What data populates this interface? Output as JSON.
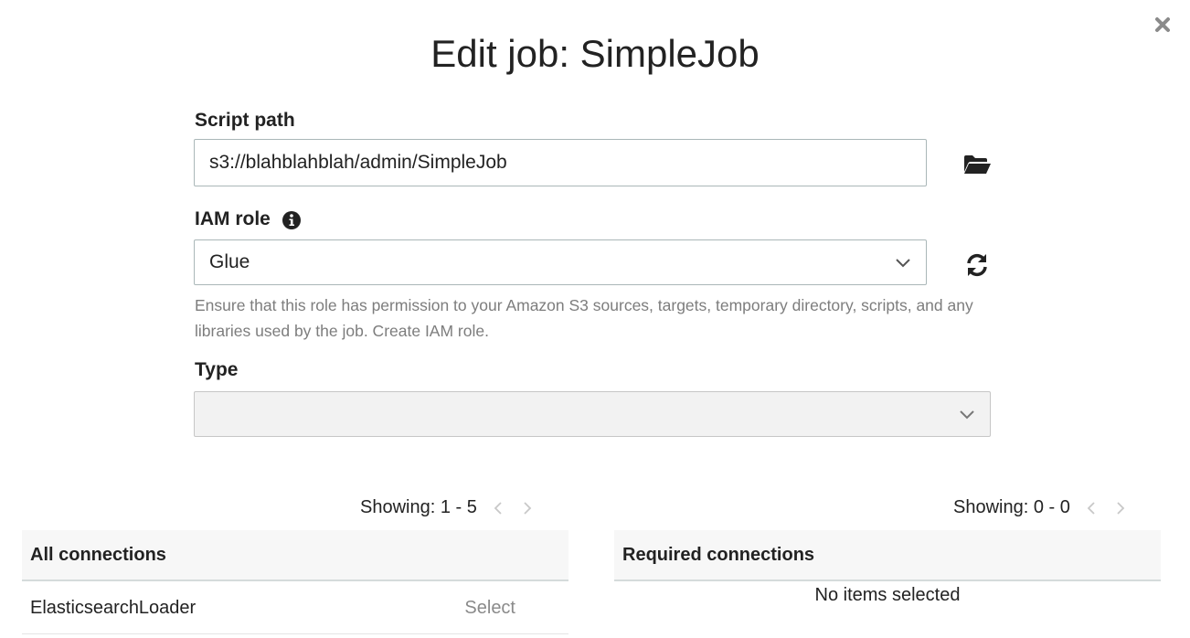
{
  "dialog": {
    "title": "Edit job: SimpleJob",
    "close_icon": "close-icon"
  },
  "script_path": {
    "label": "Script path",
    "value": "s3://blahblahblah/admin/SimpleJob",
    "browse_icon": "folder-open-icon"
  },
  "iam_role": {
    "label": "IAM role",
    "info_icon": "info-icon",
    "selected": "Glue",
    "refresh_icon": "refresh-icon",
    "help_text": "Ensure that this role has permission to your Amazon S3 sources, targets, temporary directory, scripts, and any libraries used by the job. Create IAM role."
  },
  "type": {
    "label": "Type",
    "selected": ""
  },
  "all_connections": {
    "showing": "Showing: 1 - 5",
    "header": "All connections",
    "rows": [
      {
        "name": "ElasticsearchLoader",
        "action": "Select"
      }
    ]
  },
  "required_connections": {
    "showing": "Showing: 0 - 0",
    "header": "Required connections",
    "empty_text": "No items selected"
  },
  "colors": {
    "text": "#222222",
    "muted": "#7d7d7d",
    "border": "#aab7b8",
    "disabled_bg": "#f2f2f2",
    "header_bg": "#f7f7f7"
  }
}
